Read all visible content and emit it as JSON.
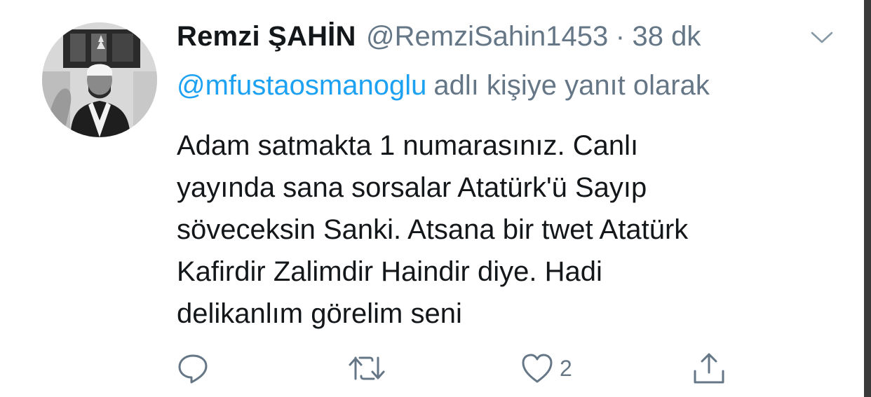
{
  "tweet": {
    "display_name": "Remzi ŞAHİN",
    "handle": "@RemziSahin1453",
    "separator": "·",
    "time": "38 dk",
    "reply_to": {
      "mention": "@mfustaosmanoglu",
      "text": "adlı kişiye yanıt olarak"
    },
    "body_lines": [
      "Adam satmakta 1 numarasınız. Canlı",
      "yayında sana sorsalar Atatürk'ü Sayıp",
      "söveceksin Sanki. Atsana bir twet Atatürk",
      "Kafirdir Zalimdir Haindir diye. Hadi",
      "delikanlım görelim seni"
    ],
    "actions": {
      "reply_icon": "reply-icon",
      "retweet_icon": "retweet-icon",
      "like_icon": "heart-icon",
      "like_count": "2",
      "share_icon": "share-icon"
    }
  },
  "colors": {
    "text": "#14171a",
    "secondary": "#657786",
    "link": "#1da1f2",
    "background": "#ffffff"
  }
}
